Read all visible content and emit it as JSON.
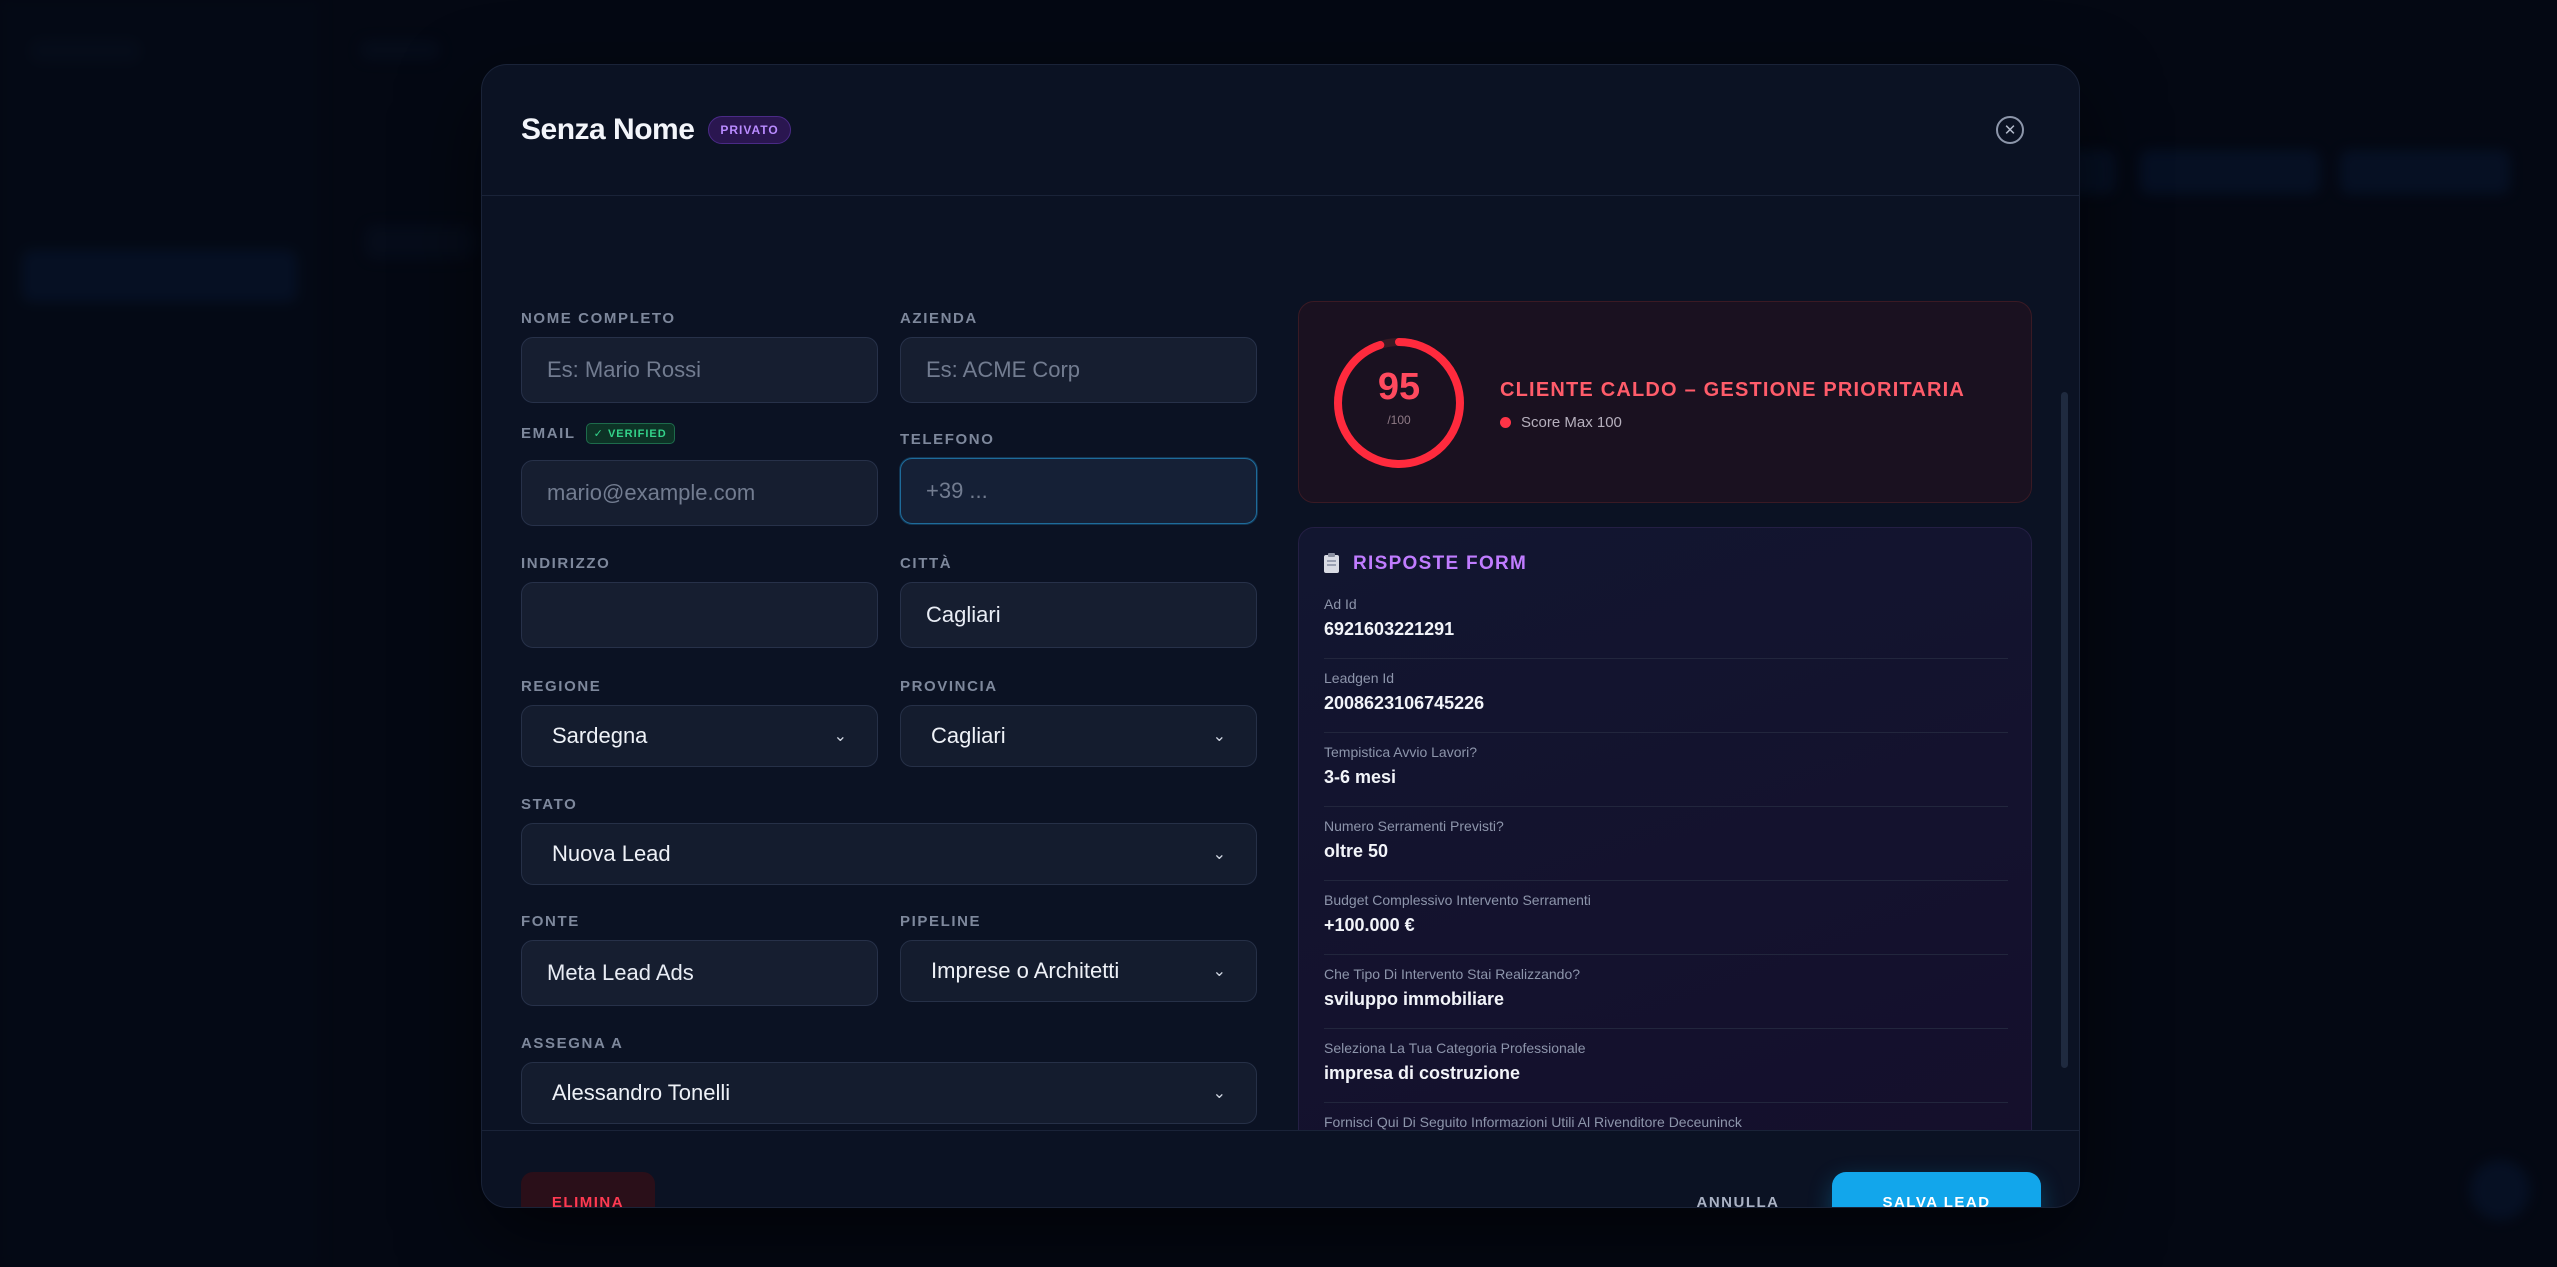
{
  "modal": {
    "title": "Senza Nome",
    "badge": "PRIVATO",
    "close_icon": "close-circle-icon"
  },
  "form": {
    "nome_completo": {
      "label": "NOME COMPLETO",
      "value": "",
      "placeholder": "Es: Mario Rossi"
    },
    "azienda": {
      "label": "AZIENDA",
      "value": "",
      "placeholder": "Es: ACME Corp"
    },
    "email": {
      "label": "EMAIL",
      "verified": "✓ VERIFIED",
      "value": "",
      "placeholder": "mario@example.com"
    },
    "telefono": {
      "label": "TELEFONO",
      "value": "",
      "placeholder": "+39 ..."
    },
    "indirizzo": {
      "label": "INDIRIZZO",
      "value": "",
      "placeholder": ""
    },
    "citta": {
      "label": "CITTÀ",
      "value": "Cagliari",
      "placeholder": ""
    },
    "regione": {
      "label": "REGIONE",
      "value": "Sardegna"
    },
    "provincia": {
      "label": "PROVINCIA",
      "value": "Cagliari"
    },
    "stato": {
      "label": "STATO",
      "value": "Nuova Lead"
    },
    "fonte": {
      "label": "FONTE",
      "value": "Meta Lead Ads",
      "placeholder": ""
    },
    "pipeline": {
      "label": "PIPELINE",
      "value": "Imprese o Architetti"
    },
    "assegna_a": {
      "label": "ASSEGNA A",
      "value": "Alessandro Tonelli"
    }
  },
  "score": {
    "value": "95",
    "value_fraction": 0.95,
    "max": "/100",
    "title": "CLIENTE CALDO – GESTIONE PRIORITARIA",
    "subtitle": "Score Max 100",
    "color": "#ff2a3d"
  },
  "answers": {
    "title": "RISPOSTE FORM",
    "icon": "clipboard-icon",
    "items": [
      {
        "q": "Ad Id",
        "a": "6921603221291"
      },
      {
        "q": "Leadgen Id",
        "a": "2008623106745226"
      },
      {
        "q": "Tempistica Avvio Lavori?",
        "a": "3-6 mesi"
      },
      {
        "q": "Numero Serramenti Previsti?",
        "a": "oltre 50"
      },
      {
        "q": "Budget Complessivo Intervento Serramenti",
        "a": "+100.000 €"
      },
      {
        "q": "Che Tipo Di Intervento Stai Realizzando?",
        "a": "sviluppo immobiliare"
      },
      {
        "q": "Seleziona La Tua Categoria Professionale",
        "a": "impresa di costruzione"
      },
      {
        "q": "Fornisci Qui Di Seguito Informazioni Utili Al Rivenditore Deceuninck",
        "a": ""
      }
    ]
  },
  "footer": {
    "delete_label": "ELIMINA",
    "cancel_label": "ANNULLA",
    "save_label": "SALVA LEAD"
  },
  "colors": {
    "accent": "#12a6eb",
    "danger": "#ff3a52",
    "purple": "#c07cff"
  }
}
